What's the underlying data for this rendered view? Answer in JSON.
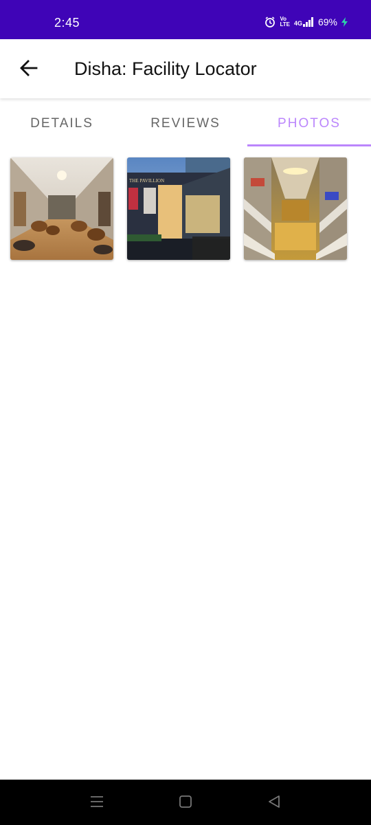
{
  "status_bar": {
    "time": "2:45",
    "battery": "69%",
    "network_top": "Vo",
    "network_bottom": "LTE",
    "signal_label": "4G",
    "icons": [
      "alarm-icon",
      "volte-icon",
      "signal-icon",
      "battery-icon"
    ]
  },
  "app_bar": {
    "title": "Disha: Facility Locator",
    "back_icon": "arrow-left-icon"
  },
  "tabs": [
    {
      "label": "DETAILS",
      "active": false
    },
    {
      "label": "REVIEWS",
      "active": false
    },
    {
      "label": "PHOTOS",
      "active": true
    }
  ],
  "photos": [
    {
      "subject": "mall interior lounge with chairs"
    },
    {
      "subject": "mall exterior at dusk",
      "sign_text": "THE PAVILLION"
    },
    {
      "subject": "multi-level mall atrium with escalators"
    }
  ],
  "nav_bar": {
    "icons": [
      "menu-icon",
      "home-square-icon",
      "back-triangle-icon"
    ]
  },
  "colors": {
    "status_bar": "#3f04b7",
    "accent": "#bb86fc",
    "tab_inactive": "#666666"
  }
}
